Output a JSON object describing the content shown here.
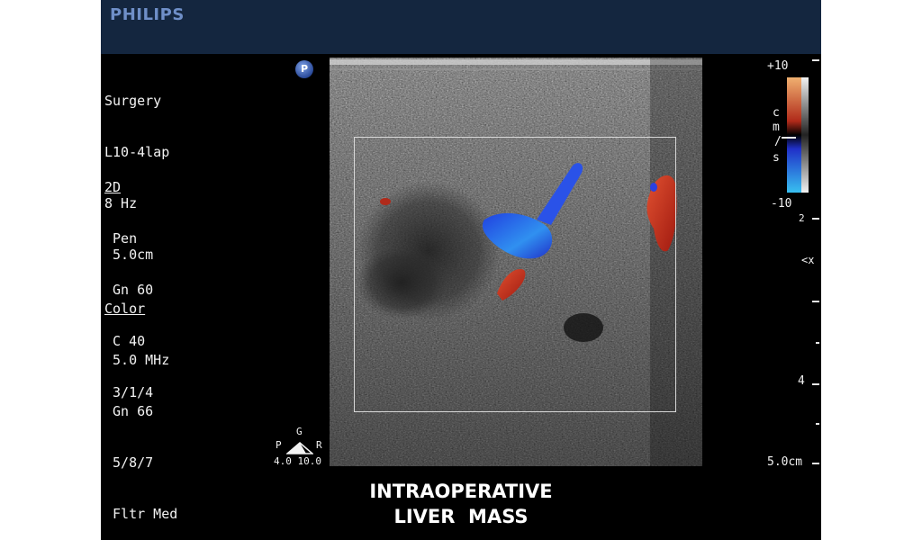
{
  "header": {
    "brand": "PHILIPS"
  },
  "params_top": {
    "preset": "Surgery",
    "probe": "L10-4lap",
    "frame_rate": "8 Hz",
    "depth": " 5.0cm"
  },
  "params_2d": {
    "title": "2D",
    "l1": " Pen",
    "l2": " Gn 60",
    "l3": " C 40",
    "l4": " 3/1/4"
  },
  "params_color": {
    "title": "Color",
    "l1": " 5.0 MHz",
    "l2": " Gn 66",
    "l3": " 5/8/7",
    "l4": " Fltr Med"
  },
  "badge": "P",
  "color_scale": {
    "max": "+10",
    "min": "-10",
    "unit_c": "c",
    "unit_m": "m",
    "unit_slash": "/",
    "unit_s": "s",
    "colors": {
      "positive_top": "#f0b070",
      "positive_mid": "#b02a1a",
      "negative_mid": "#2030c8",
      "negative_bottom": "#38c0f0"
    }
  },
  "depth_scale": {
    "mark_2": "2",
    "mark_4": "4",
    "bottom": "5.0cm",
    "focus_marker": "<x"
  },
  "orientation": {
    "top": "G",
    "left": "P",
    "right": "R",
    "values": "4.0 10.0"
  },
  "caption": {
    "line1": "INTRAOPERATIVE",
    "line2": "LIVER  MASS"
  }
}
